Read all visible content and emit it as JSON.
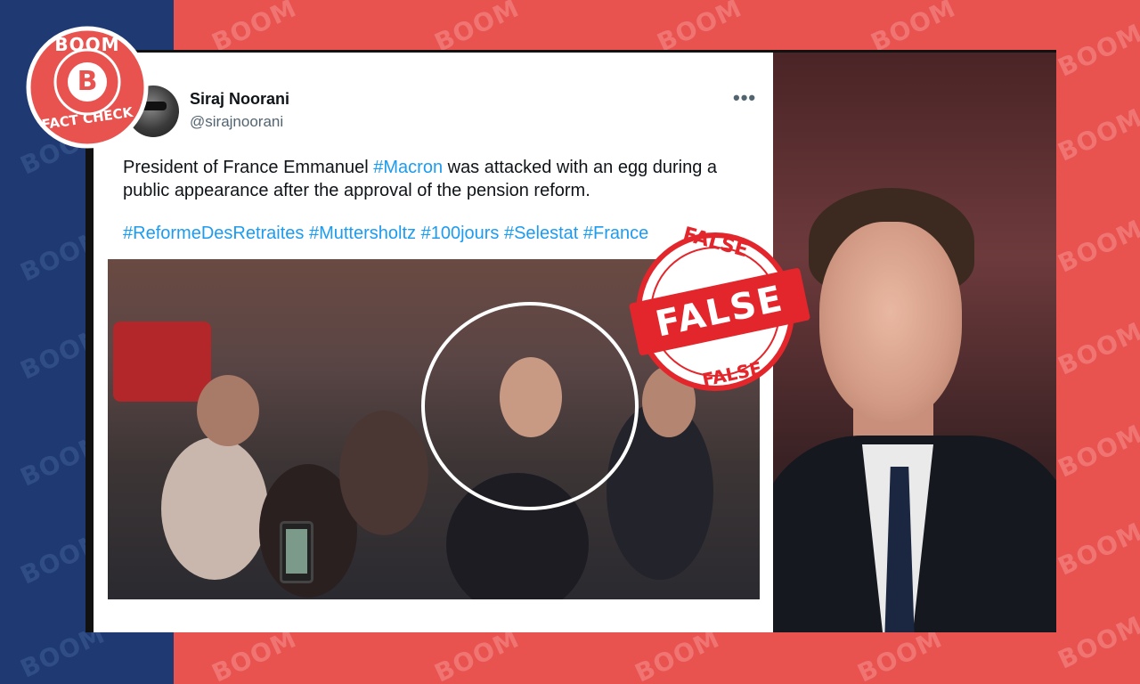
{
  "brand": {
    "logo_top": "BOOM",
    "logo_letter": "B",
    "logo_bottom": "FACT CHECK",
    "watermark": "BOOM",
    "colors": {
      "red": "#e8524f",
      "navy": "#1f3a73",
      "link": "#1d9bf0"
    }
  },
  "tweet": {
    "author_name": "Siraj Noorani",
    "author_handle": "@sirajnoorani",
    "more_icon": "•••",
    "text_before": "President of France Emmanuel ",
    "text_hashtag": "#Macron",
    "text_after": " was attacked with an egg during a public appearance after the approval of the pension reform.",
    "hashtags": "#ReformeDesRetraites #Muttersholtz #100jours #Selestat #France"
  },
  "stamp": {
    "top": "FALSE",
    "main": "FALSE",
    "bottom": "FALSE"
  }
}
